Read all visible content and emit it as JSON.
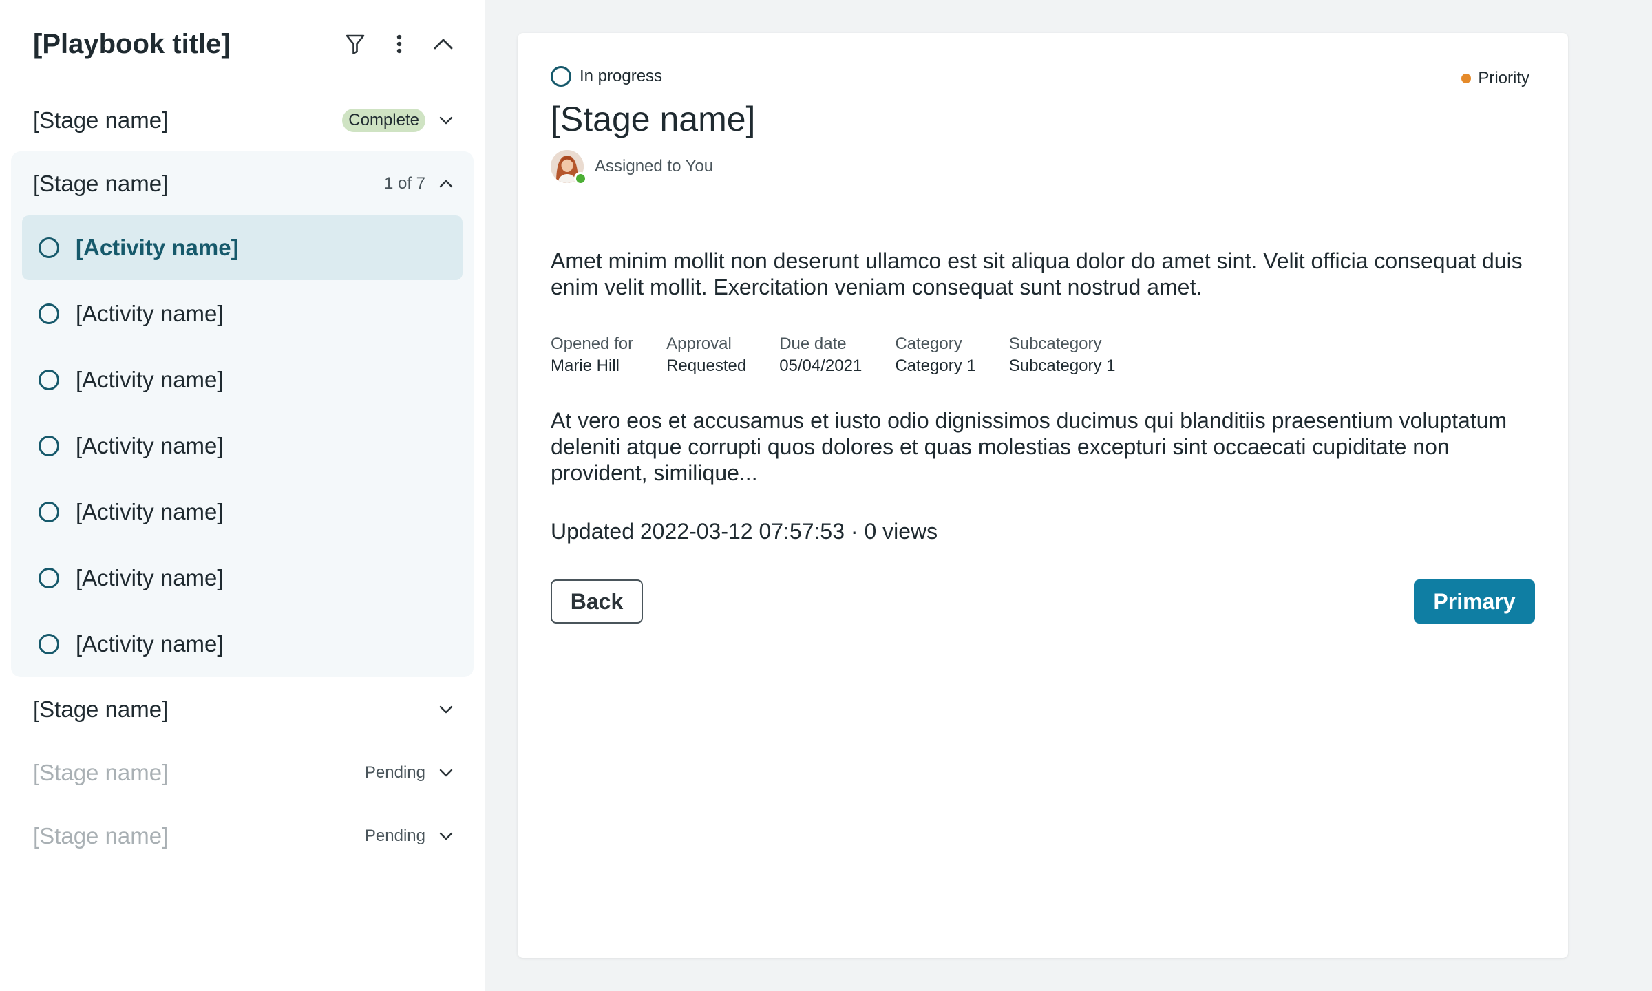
{
  "sidebar": {
    "title": "[Playbook title]",
    "stages": [
      {
        "name": "[Stage name]",
        "badge": "Complete",
        "state": "complete"
      },
      {
        "name": "[Stage name]",
        "progress": "1 of 7",
        "state": "open"
      },
      {
        "name": "[Stage name]",
        "state": "collapsed"
      },
      {
        "name": "[Stage name]",
        "status": "Pending",
        "state": "pending"
      },
      {
        "name": "[Stage name]",
        "status": "Pending",
        "state": "pending"
      }
    ],
    "activities": [
      {
        "label": "[Activity name]",
        "active": true
      },
      {
        "label": "[Activity name]"
      },
      {
        "label": "[Activity name]"
      },
      {
        "label": "[Activity name]"
      },
      {
        "label": "[Activity name]"
      },
      {
        "label": "[Activity name]"
      },
      {
        "label": "[Activity name]"
      }
    ]
  },
  "detail": {
    "status": "In progress",
    "priority": "Priority",
    "title": "[Stage name]",
    "assigned": "Assigned to You",
    "description": "Amet minim mollit non deserunt ullamco est sit aliqua dolor do amet sint. Velit officia consequat duis enim velit mollit. Exercitation veniam consequat sunt nostrud amet.",
    "meta": [
      {
        "label": "Opened for",
        "value": "Marie Hill"
      },
      {
        "label": "Approval",
        "value": "Requested"
      },
      {
        "label": "Due date",
        "value": "05/04/2021"
      },
      {
        "label": "Category",
        "value": "Category 1"
      },
      {
        "label": "Subcategory",
        "value": "Subcategory 1"
      }
    ],
    "description2": "At vero eos et accusamus et iusto odio dignissimos ducimus qui blanditiis praesentium voluptatum deleniti atque corrupti quos dolores et quas molestias excepturi sint occaecati cupiditate non provident, similique...",
    "updated": "Updated 2022-03-12 07:57:53 · 0 views",
    "back_label": "Back",
    "primary_label": "Primary"
  },
  "colors": {
    "accent": "#16596b",
    "primary_button": "#0f7ea3",
    "active_item_bg": "#dcebf0",
    "open_stage_bg": "#f4f8fa",
    "complete_badge": "#cfe3c3",
    "priority_dot": "#e58a2a",
    "online_status": "#4caf35"
  },
  "icons": {
    "filter": "filter-icon",
    "more": "more-vertical-icon",
    "collapse": "chevron-up-icon",
    "expand": "chevron-down-icon"
  }
}
